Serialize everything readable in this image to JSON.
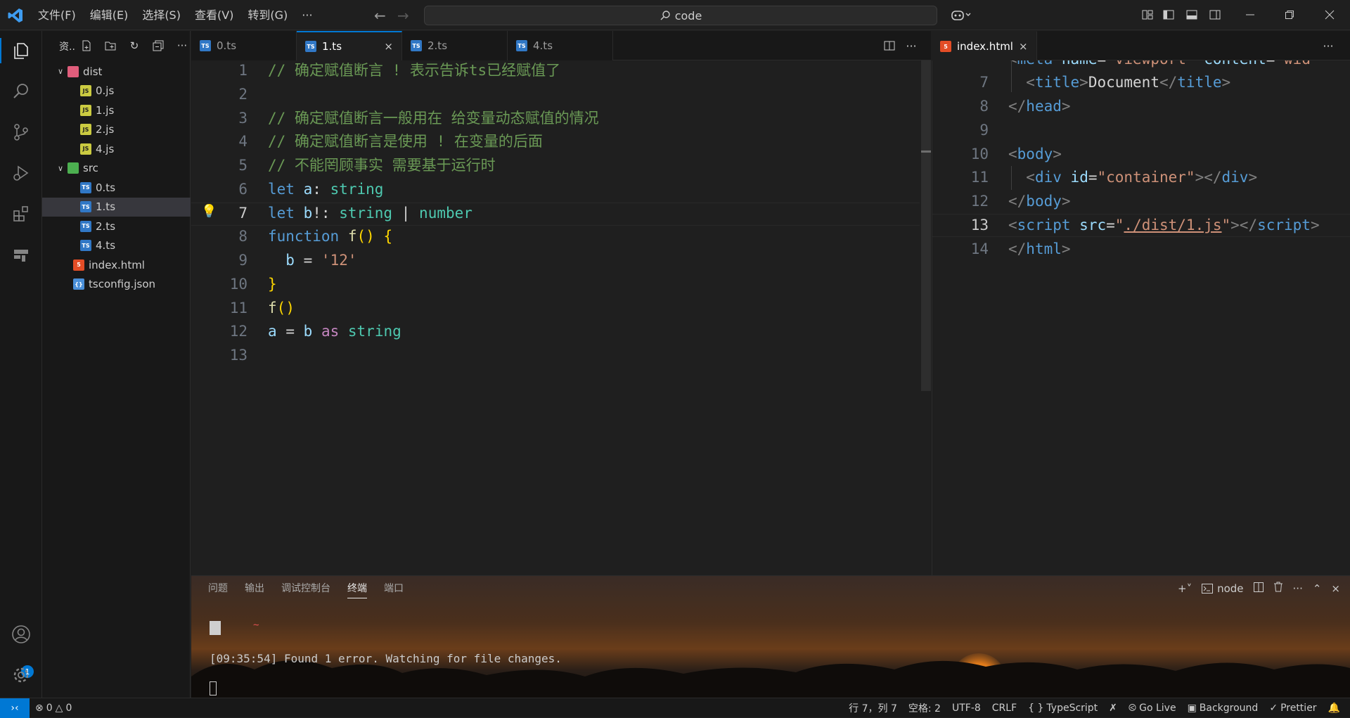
{
  "titlebar": {
    "menus": [
      "文件(F)",
      "编辑(E)",
      "选择(S)",
      "查看(V)",
      "转到(G)"
    ],
    "more": "···",
    "search_text": "code"
  },
  "sidebar": {
    "title": "资..",
    "tree": [
      {
        "label": "dist",
        "kind": "folder-dist",
        "depth": 0,
        "expanded": true
      },
      {
        "label": "0.js",
        "kind": "js",
        "depth": 1
      },
      {
        "label": "1.js",
        "kind": "js",
        "depth": 1
      },
      {
        "label": "2.js",
        "kind": "js",
        "depth": 1
      },
      {
        "label": "4.js",
        "kind": "js",
        "depth": 1
      },
      {
        "label": "src",
        "kind": "folder-src",
        "depth": 0,
        "expanded": true
      },
      {
        "label": "0.ts",
        "kind": "ts",
        "depth": 1
      },
      {
        "label": "1.ts",
        "kind": "ts",
        "depth": 1,
        "selected": true
      },
      {
        "label": "2.ts",
        "kind": "ts",
        "depth": 1
      },
      {
        "label": "4.ts",
        "kind": "ts",
        "depth": 1
      },
      {
        "label": "index.html",
        "kind": "html",
        "depth": 0
      },
      {
        "label": "tsconfig.json",
        "kind": "json",
        "depth": 0
      }
    ]
  },
  "editor_left": {
    "tabs": [
      {
        "label": "0.ts",
        "kind": "ts"
      },
      {
        "label": "1.ts",
        "kind": "ts",
        "active": true
      },
      {
        "label": "2.ts",
        "kind": "ts"
      },
      {
        "label": "4.ts",
        "kind": "ts"
      }
    ],
    "lines": [
      "// 确定赋值断言 ! 表示告诉ts已经赋值了",
      "",
      "// 确定赋值断言一般用在 给变量动态赋值的情况",
      "// 确定赋值断言是使用 ! 在变量的后面",
      "// 不能罔顾事实 需要基于运行时",
      "let a: string",
      "let b!: string | number",
      "function f() {",
      "  b = '12'",
      "}",
      "f()",
      "a = b as string",
      ""
    ],
    "current_line": 7
  },
  "editor_right": {
    "tab": {
      "label": "index.html",
      "kind": "html"
    },
    "line_numbers": [
      "7",
      "8",
      "9",
      "10",
      "11",
      "12",
      "13",
      "14"
    ],
    "partial_top_line": "  <meta name=\"viewport\" content=\"wid",
    "current_line": "13"
  },
  "panel": {
    "tabs": [
      "问题",
      "输出",
      "调试控制台",
      "终端",
      "端口"
    ],
    "active_tab": "终端",
    "shell": "node",
    "terminal_lines": [
      "~",
      "[09:35:54] Found 1 error. Watching for file changes."
    ]
  },
  "account_badge": "1",
  "statusbar": {
    "errors": "0",
    "warnings": "0",
    "position": "行 7，列 7",
    "spaces": "空格: 2",
    "encoding": "UTF-8",
    "eol": "CRLF",
    "language": "TypeScript",
    "go_live": "Go Live",
    "background": "Background",
    "prettier": "Prettier"
  }
}
